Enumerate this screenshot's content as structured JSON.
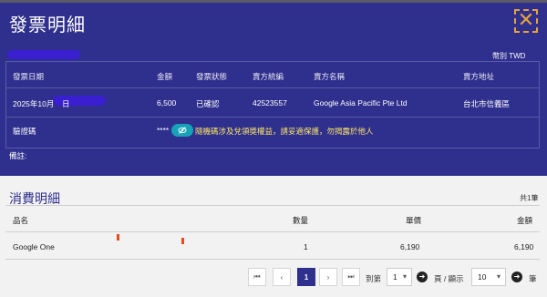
{
  "dialog": {
    "title": "發票明細",
    "close_icon": "close-icon",
    "currency_label": "幣別 TWD",
    "table": {
      "headers": [
        "發票日期",
        "金額",
        "發票狀態",
        "賣方統編",
        "賣方名稱",
        "賣方地址"
      ],
      "row": [
        "2025年10月",
        "6,500",
        "已確認",
        "42523557",
        "Google Asia Pacific Pte Ltd",
        "台北市信義區"
      ],
      "date_day_suffix": "日",
      "verify_label": "驗證碼",
      "verify_masked": "****",
      "verify_icon": "eye-slash-icon",
      "verify_note": "隨機碼涉及兌領獎權益，請妥適保護，勿揭露於他人"
    },
    "remark_label": "備註:"
  },
  "details": {
    "title": "消費明細",
    "count": "共1筆",
    "headers": {
      "name": "品名",
      "qty": "數量",
      "unit_price": "單價",
      "amount": "金額"
    },
    "rows": [
      {
        "name": "Google One",
        "qty": "1",
        "unit_price": "6,190",
        "amount": "6,190"
      }
    ]
  },
  "pagination": {
    "first_icon": "first-page-icon",
    "prev_icon": "prev-page-icon",
    "current_page": "1",
    "next_icon": "next-page-icon",
    "last_icon": "last-page-icon",
    "goto_label": "到第",
    "page_select_value": "1",
    "page_label": "頁 / 顯示",
    "size_select_value": "10",
    "size_label": "筆"
  },
  "colors": {
    "header_bg": "#2f2f8e",
    "accent": "#17a2b8",
    "warning_text": "#ffe866",
    "close": "#e6a23c"
  }
}
